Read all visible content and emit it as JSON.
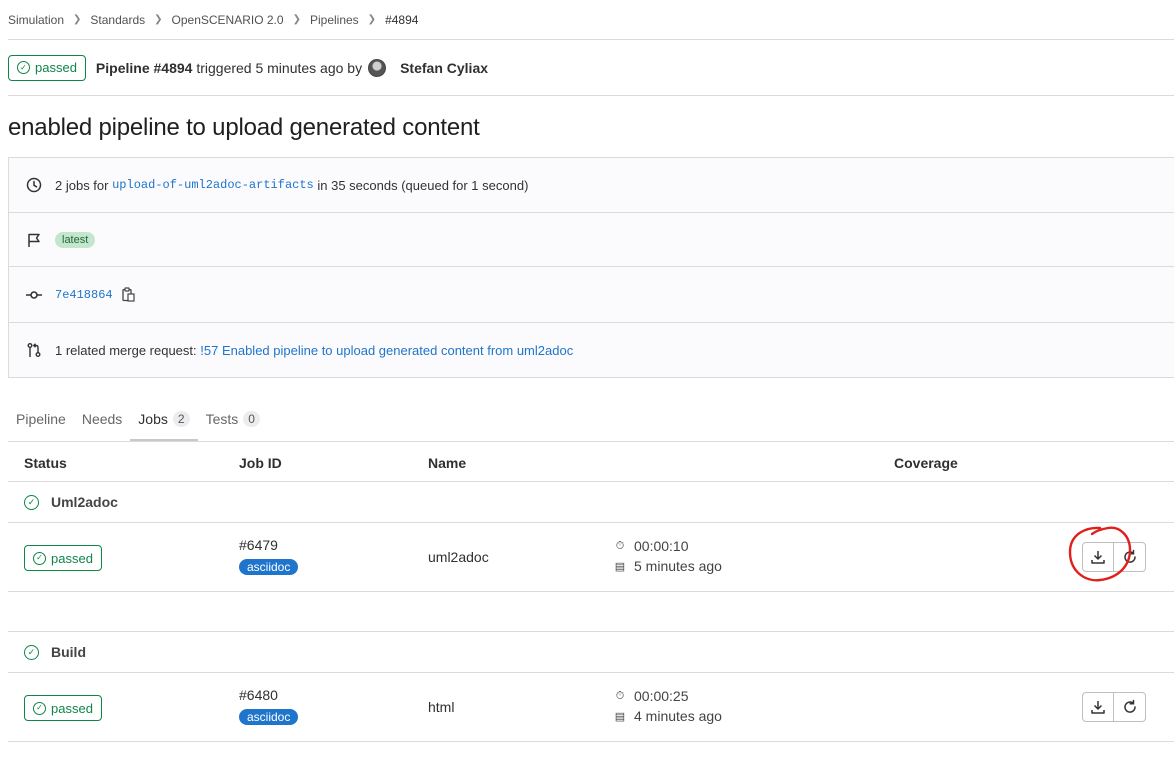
{
  "breadcrumb": [
    "Simulation",
    "Standards",
    "OpenSCENARIO 2.0",
    "Pipelines",
    "#4894"
  ],
  "header": {
    "status": "passed",
    "pipeline_label": "Pipeline #4894",
    "triggered_text": "triggered 5 minutes ago by",
    "user": "Stefan Cyliax"
  },
  "title": "enabled pipeline to upload generated content",
  "info": {
    "jobs_prefix": "2 jobs for",
    "branch": "upload-of-uml2adoc-artifacts",
    "jobs_suffix": "in 35 seconds (queued for 1 second)",
    "badge": "latest",
    "commit": "7e418864",
    "mr_prefix": "1 related merge request:",
    "mr_link": "!57 Enabled pipeline to upload generated content from uml2adoc"
  },
  "tabs": [
    {
      "label": "Pipeline",
      "count": ""
    },
    {
      "label": "Needs",
      "count": ""
    },
    {
      "label": "Jobs",
      "count": "2"
    },
    {
      "label": "Tests",
      "count": "0"
    }
  ],
  "table": {
    "headers": {
      "status": "Status",
      "job_id": "Job ID",
      "name": "Name",
      "coverage": "Coverage"
    },
    "stages": [
      {
        "name": "Uml2adoc",
        "job": {
          "status": "passed",
          "id": "#6479",
          "tag": "asciidoc",
          "name": "uml2adoc",
          "duration": "00:00:10",
          "finished": "5 minutes ago"
        }
      },
      {
        "name": "Build",
        "job": {
          "status": "passed",
          "id": "#6480",
          "tag": "asciidoc",
          "name": "html",
          "duration": "00:00:25",
          "finished": "4 minutes ago"
        }
      }
    ]
  },
  "colors": {
    "success": "#108548",
    "link": "#1f75cb",
    "annotation": "#e0201b"
  }
}
